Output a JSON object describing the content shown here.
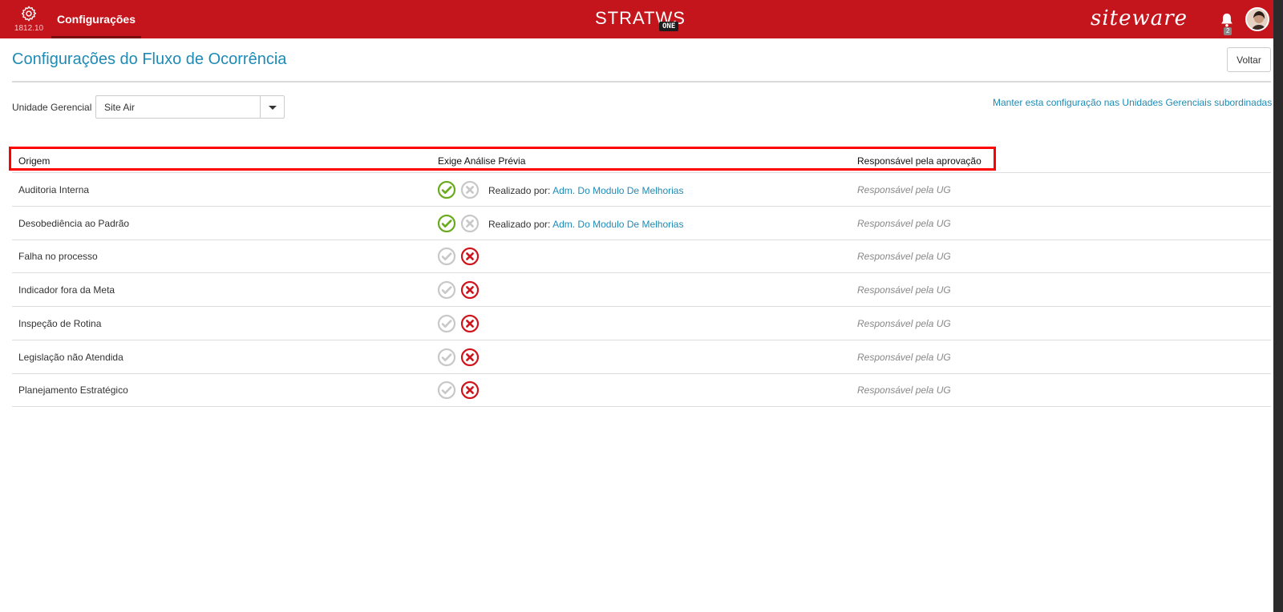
{
  "header": {
    "version": "1812.10",
    "nav_tab": "Configurações",
    "logo_word": "STRATWS",
    "logo_badge": "ONE",
    "brand": "siteware",
    "notification_count": "2"
  },
  "page": {
    "title": "Configurações do Fluxo de Ocorrência",
    "back_label": "Voltar",
    "unit_label": "Unidade Gerencial",
    "unit_value": "Site Air",
    "sub_link": "Manter esta configuração nas Unidades Gerenciais subordinadas"
  },
  "table": {
    "col_origin": "Origem",
    "col_analysis": "Exige Análise Prévia",
    "col_responsible": "Responsável pela aprovação",
    "realizado_prefix": "Realizado por: ",
    "rows": [
      {
        "origin": "Auditoria Interna",
        "requires": true,
        "performed_by": "Adm. Do Modulo De Melhorias",
        "responsible": "Responsável pela UG"
      },
      {
        "origin": "Desobediência ao Padrão",
        "requires": true,
        "performed_by": "Adm. Do Modulo De Melhorias",
        "responsible": "Responsável pela UG"
      },
      {
        "origin": "Falha no processo",
        "requires": false,
        "performed_by": "",
        "responsible": "Responsável pela UG"
      },
      {
        "origin": "Indicador fora da Meta",
        "requires": false,
        "performed_by": "",
        "responsible": "Responsável pela UG"
      },
      {
        "origin": "Inspeção de Rotina",
        "requires": false,
        "performed_by": "",
        "responsible": "Responsável pela UG"
      },
      {
        "origin": "Legislação não Atendida",
        "requires": false,
        "performed_by": "",
        "responsible": "Responsável pela UG"
      },
      {
        "origin": "Planejamento Estratégico",
        "requires": false,
        "performed_by": "",
        "responsible": "Responsável pela UG"
      }
    ]
  },
  "colors": {
    "brand_red": "#c5151c",
    "link_blue": "#1f8bb5",
    "yes_green": "#6aaa1e",
    "no_red": "#d0141c",
    "inactive_gray": "#c8c8c8"
  }
}
